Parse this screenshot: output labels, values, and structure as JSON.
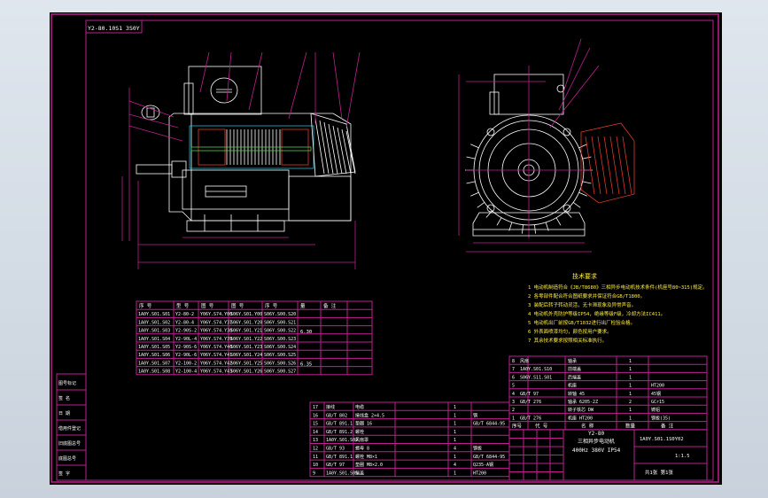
{
  "drawing": {
    "corner_code": "Y2-80.10S1 3S0Y",
    "tech_title": "技术要求",
    "tech_notes": [
      "1 电动机制造符合《JB/T8680》三相异步电动机技术条件(机座号80~315)规定。",
      "2 各零部件配合符合图纸要求并保证符合GB/T1800。",
      "3 装配后转子转动灵活，无卡滞现象及异常声音。",
      "4 电动机外壳防护等级IP54，绝缘等级F级，冷却方法IC411。",
      "5 电动机出厂前按GB/T1032进行出厂检验合格。",
      "6 外表面喷漆均匀，颜色按用户要求。",
      "7 其余技术要求按照相关标准执行。"
    ],
    "left_table": {
      "headers": [
        "序 号",
        "型 号",
        "图 号",
        "图 号",
        "序 号",
        "量",
        "备 注"
      ],
      "rows": [
        [
          "1A0Y.S01.S01",
          "Y2-80-2",
          "Y06Y.S74.Y00",
          "S06Y.S01.Y00",
          "S06Y.S00.S20"
        ],
        [
          "1A0Y.S01.S02",
          "Y2-80-4",
          "Y06Y.S74.Y37",
          "S06Y.S01.Y20",
          "S06Y.S00.S21"
        ],
        [
          "1A0Y.S01.S03",
          "Y2-90S-2",
          "Y06Y.S74.Y38",
          "S06Y.S01.Y21",
          "S06Y.S00.S22"
        ],
        [
          "1A0Y.S01.S04",
          "Y2-90L-4",
          "Y06Y.S74.Y39",
          "S06Y.S01.Y22",
          "S06Y.S00.S23"
        ],
        [
          "1A0Y.S01.S05",
          "Y2-90S-6",
          "Y06Y.S74.Y40",
          "S06Y.S01.Y23",
          "S06Y.S00.S24"
        ],
        [
          "1A0Y.S01.S06",
          "Y2-90L-6",
          "Y06Y.S74.Y41",
          "S06Y.S01.Y24",
          "S06Y.S00.S25"
        ],
        [
          "1A0Y.S01.S07",
          "Y2-100-2",
          "Y06Y.S74.Y42",
          "S06Y.S01.Y25",
          "S06Y.S00.S26"
        ],
        [
          "1A0Y.S01.S08",
          "Y2-100-4",
          "Y06Y.S74.Y43",
          "S06Y.S01.Y26",
          "S06Y.S00.S27"
        ]
      ],
      "qty_a": "6.30",
      "qty_b": "6.35"
    },
    "bom_rows": [
      [
        "17",
        "接线",
        "电缆",
        "1",
        ""
      ],
      [
        "16",
        "GB/T 802",
        "接线盒 2×4.5",
        "1",
        "钢"
      ],
      [
        "15",
        "GB/T 891.1",
        "垫圈 16",
        "1",
        "GB/T 6844-95"
      ],
      [
        "14",
        "GB/T 891.2",
        "螺栓",
        "1",
        ""
      ],
      [
        "13",
        "1A0Y.S01.S02",
        "风扇罩",
        "1",
        ""
      ],
      [
        "12",
        "GB/T 93",
        "螺母 8",
        "4",
        "钢板"
      ],
      [
        "11",
        "GB/T 891.1",
        "螺栓 M8×1",
        "1",
        "GB/T 6844-95"
      ],
      [
        "10",
        "GB/T 97",
        "垫圈 M8×2.0",
        "4",
        "Q235-A钢"
      ],
      [
        "9",
        "1A0Y.S01.S05",
        "端盖",
        "1",
        "HT200"
      ]
    ],
    "right_rows": [
      [
        "8",
        "风扇",
        "轴承",
        "1",
        ""
      ],
      [
        "7",
        "1A0Y.S01.S10",
        "前端盖",
        "1",
        ""
      ],
      [
        "6",
        "S06Y.S11.S01",
        "后端盖",
        "1",
        ""
      ],
      [
        "5",
        "",
        "机座",
        "1",
        "HT200"
      ],
      [
        "4",
        "GB/T 97",
        "转轴 45",
        "1",
        "45钢"
      ],
      [
        "3",
        "GB/T 276",
        "轴承 6205-2Z",
        "2",
        "GCr15"
      ],
      [
        "2",
        "",
        "转子铁芯 DW",
        "1",
        "铸铝"
      ],
      [
        "1",
        "GB/T 276",
        "机座 HT200",
        "1",
        "钢板(35)"
      ]
    ],
    "bom_header": [
      "序号",
      "代 号",
      "名 称",
      "数量",
      "备 注"
    ],
    "title_block": {
      "model": "Y2-80",
      "name": "三相异步电动机",
      "spec": "400Hz 380V IP54",
      "drawing_no": "1A0Y.S01.1S0Y02",
      "scale": "1:1.5",
      "sheet": "共1张 第1张"
    },
    "left_strip": [
      "图号标记",
      "签 名",
      "日 期",
      "借用件登记",
      "旧底图总号",
      "底图总号",
      "签 字"
    ]
  }
}
